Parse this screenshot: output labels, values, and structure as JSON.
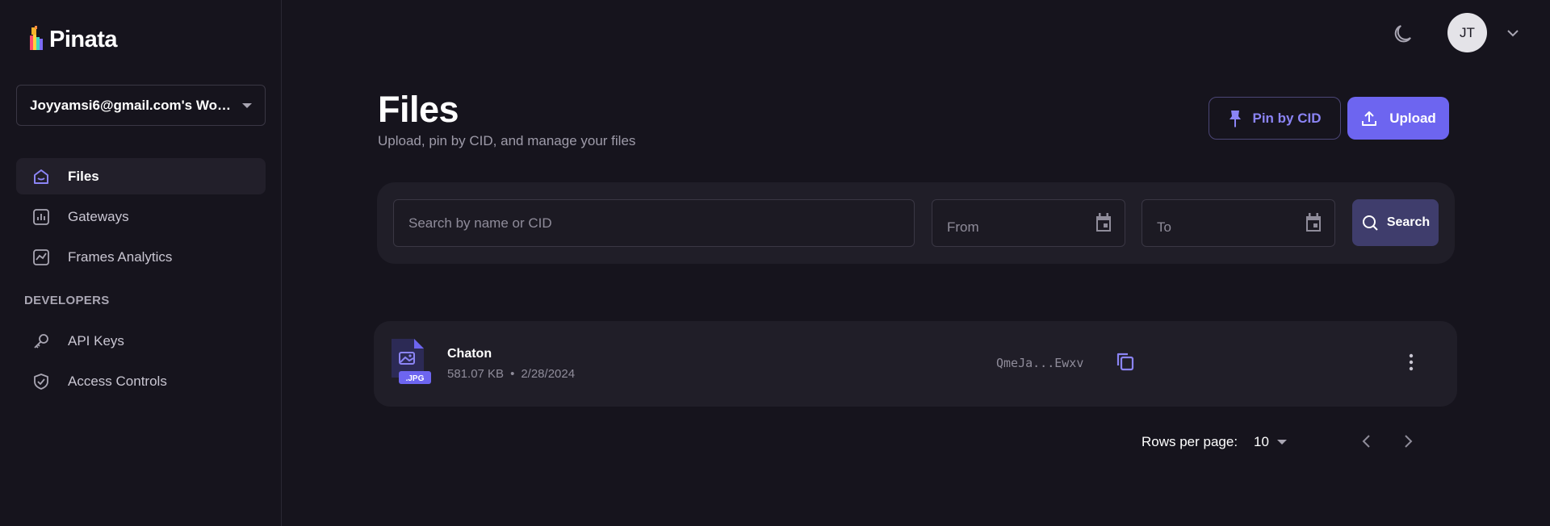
{
  "brand": {
    "name": "Pinata"
  },
  "workspace": {
    "label": "Joyyamsi6@gmail.com's Wor..."
  },
  "nav": {
    "items": [
      {
        "label": "Files",
        "icon": "home-icon",
        "active": true
      },
      {
        "label": "Gateways",
        "icon": "bar-chart-icon",
        "active": false
      },
      {
        "label": "Frames Analytics",
        "icon": "analytics-icon",
        "active": false
      }
    ],
    "developers_title": "DEVELOPERS",
    "developer_items": [
      {
        "label": "API Keys",
        "icon": "key-icon"
      },
      {
        "label": "Access Controls",
        "icon": "shield-check-icon"
      }
    ]
  },
  "user": {
    "initials": "JT"
  },
  "header": {
    "title": "Files",
    "subtitle": "Upload, pin by CID, and manage your files",
    "pin_button": "Pin by CID",
    "upload_button": "Upload"
  },
  "search": {
    "placeholder": "Search by name or CID",
    "from_label": "From",
    "to_label": "To",
    "button": "Search"
  },
  "files": [
    {
      "name": "Chaton",
      "size": "581.07 KB",
      "date": "2/28/2024",
      "ext": ".JPG",
      "cid": "QmeJa...Ewxv"
    }
  ],
  "pagination": {
    "rows_label": "Rows per page:",
    "rows_value": "10"
  },
  "colors": {
    "background": "#16141d",
    "panel": "#201e28",
    "accent": "#6d65f0",
    "accent_text": "#8b84f5",
    "muted": "#8f8c9a"
  }
}
